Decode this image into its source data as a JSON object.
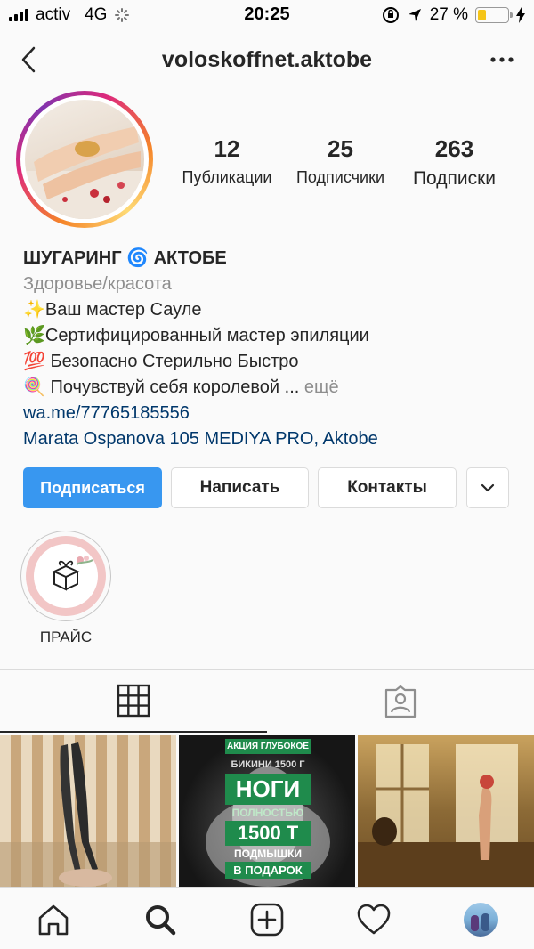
{
  "status_bar": {
    "carrier": "activ",
    "network": "4G",
    "time": "20:25",
    "battery_percent": "27 %",
    "battery_level": 0.27
  },
  "header": {
    "username": "voloskoffnet.aktobe"
  },
  "profile": {
    "stats": [
      {
        "count": "12",
        "label": "Публикации"
      },
      {
        "count": "25",
        "label": "Подписчики"
      },
      {
        "count": "263",
        "label": "Подписки"
      }
    ],
    "name": "ШУГАРИНГ 🌀 АКТОБЕ",
    "category": "Здоровье/красота",
    "bio_lines": [
      "✨Ваш мастер Сауле",
      "🌿Сертифицированный мастер эпиляции",
      "💯 Безопасно Стерильно Быстро",
      "🍭 Почувствуй себя королевой ..."
    ],
    "more_label": "ещё",
    "website": "wa.me/77765185556",
    "address": "Marata Ospanova 105 MEDIYA PRO, Aktobe"
  },
  "actions": {
    "follow": "Подписаться",
    "message": "Написать",
    "contacts": "Контакты"
  },
  "highlights": [
    {
      "label": "ПРАЙС"
    }
  ],
  "posts": {
    "promo": {
      "line1": "АКЦИЯ ГЛУБОКОЕ",
      "line2": "БИКИНИ 1500 Г",
      "line3": "НОГИ",
      "line4": "ПОЛНОСТЬЮ",
      "line5": "1500 Т",
      "line6": "ПОДМЫШКИ",
      "line7": "В ПОДАРОК"
    }
  },
  "colors": {
    "follow_button": "#3897f0",
    "link": "#00376b",
    "muted": "#8e8e8e"
  }
}
